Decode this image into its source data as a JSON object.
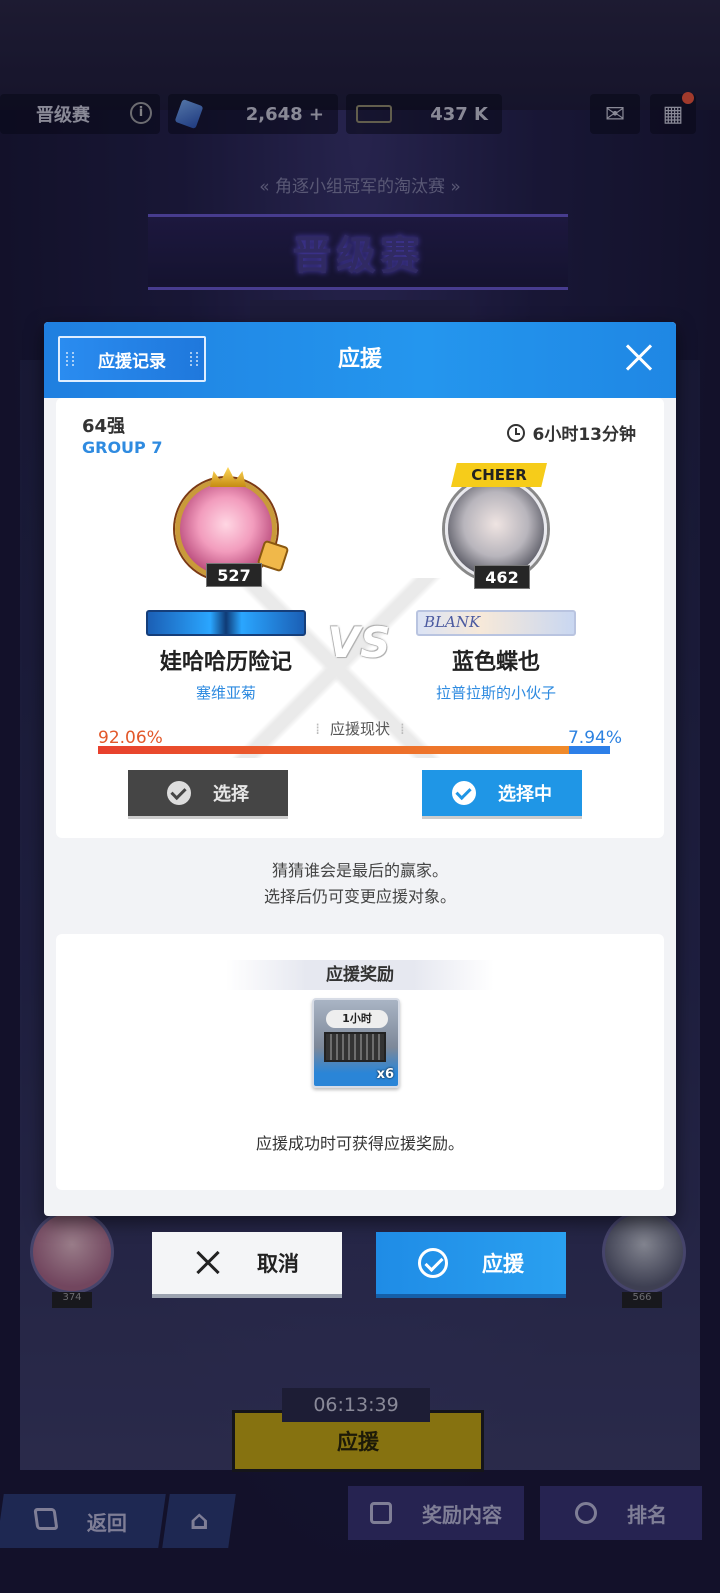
{
  "header": {
    "stage_label": "晋级赛",
    "gems": "2,648 +",
    "tickets": "437 K"
  },
  "background": {
    "subtitle": "角逐小组冠军的淘汰赛",
    "banner": "晋级赛",
    "left_level": "374",
    "right_level": "566",
    "timer": "06:13:39",
    "cheer_button": "应援"
  },
  "bottom_nav": {
    "back": "返回",
    "rewards": "奖励内容",
    "ranking": "排名"
  },
  "modal": {
    "record_button": "应援记录",
    "title": "应援",
    "round": "64强",
    "group": "GROUP 7",
    "time_left": "6小时13分钟",
    "vs": "VS",
    "status_label": "应援现状",
    "left": {
      "level": "527",
      "name": "娃哈哈历险记",
      "guild": "塞维亚菊",
      "percent": "92.06%",
      "percent_value": 92.06,
      "button": "选择"
    },
    "right": {
      "tag": "CHEER",
      "level": "462",
      "plate_text": "BLANK",
      "name": "蓝色蝶也",
      "guild": "拉普拉斯的小伙子",
      "percent": "7.94%",
      "percent_value": 7.94,
      "button": "选择中"
    },
    "hint_line1": "猜猜谁会是最后的赢家。",
    "hint_line2": "选择后仍可变更应援对象。",
    "reward": {
      "title": "应援奖励",
      "item_duration": "1小时",
      "item_qty": "x6",
      "note": "应援成功时可获得应援奖励。"
    }
  },
  "actions": {
    "cancel": "取消",
    "confirm": "应援"
  }
}
